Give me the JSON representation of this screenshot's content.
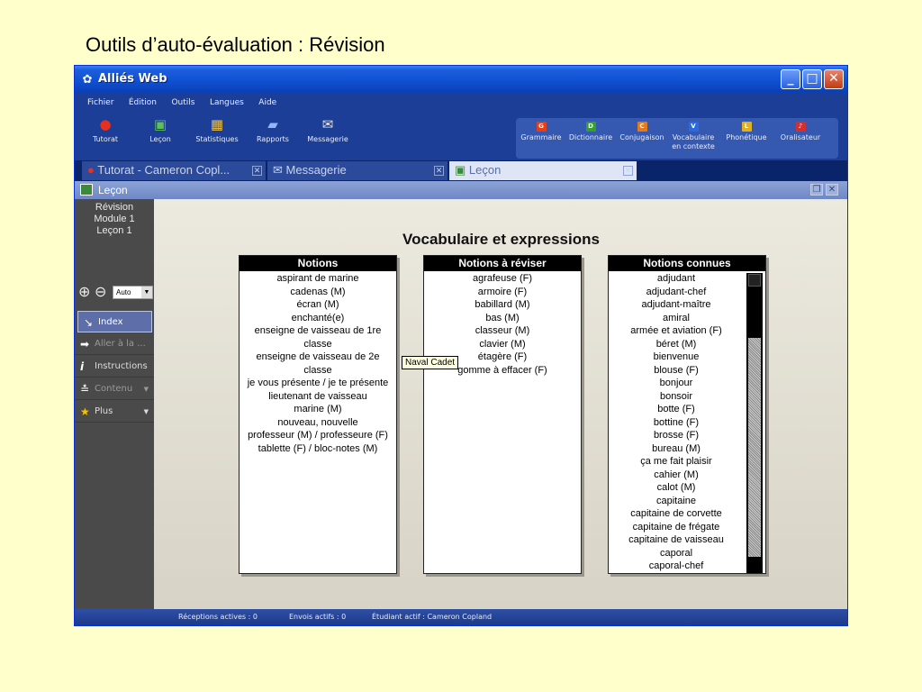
{
  "slide": {
    "title": "Outils d’auto-évaluation : Révision"
  },
  "window": {
    "title": "Alliés Web"
  },
  "menu": [
    "Fichier",
    "Édition",
    "Outils",
    "Langues",
    "Aide"
  ],
  "toolbar": {
    "items": [
      {
        "label": "Tutorat",
        "icon": "apple-icon"
      },
      {
        "label": "Leçon",
        "icon": "lesson-icon"
      },
      {
        "label": "Statistiques",
        "icon": "chart-icon"
      },
      {
        "label": "Rapports",
        "icon": "folder-icon"
      },
      {
        "label": "Messagerie",
        "icon": "mail-icon"
      }
    ],
    "references": [
      {
        "letter": "G",
        "label": "Grammaire",
        "color": "#e0401a"
      },
      {
        "letter": "D",
        "label": "Dictionnaire",
        "color": "#33a02c"
      },
      {
        "letter": "C",
        "label": "Conjugaison",
        "color": "#e07b20"
      },
      {
        "letter": "V",
        "label": "Vocabulaire en contexte",
        "color": "#2a6ae0"
      },
      {
        "letter": "L",
        "label": "Phonétique",
        "color": "#e0b020"
      },
      {
        "letter": "",
        "label": "Oralisateur",
        "color": "#d03030"
      }
    ]
  },
  "tabs": [
    {
      "label": "Tutorat - Cameron Copl..."
    },
    {
      "label": "Messagerie"
    },
    {
      "label": "Leçon"
    }
  ],
  "panel": {
    "title": "Leçon"
  },
  "sidebar": {
    "crumb": [
      "Révision",
      "Module 1",
      "Leçon 1"
    ],
    "zoom": "Auto",
    "items": [
      {
        "label": "Index"
      },
      {
        "label": "Aller à la ..."
      },
      {
        "label": "Instructions"
      },
      {
        "label": "Contenu"
      },
      {
        "label": "Plus"
      }
    ]
  },
  "main": {
    "title": "Vocabulaire et expressions",
    "columns": [
      {
        "header": "Notions",
        "items": [
          "aspirant de marine",
          "cadenas (M)",
          "écran (M)",
          "enchanté(e)",
          "enseigne de vaisseau de 1re classe",
          "enseigne de vaisseau de 2e classe",
          "je vous présente / je te présente",
          "lieutenant de vaisseau",
          "marine (M)",
          "nouveau, nouvelle",
          "professeur (M) / professeure (F)",
          "tablette (F) / bloc-notes (M)"
        ]
      },
      {
        "header": "Notions à réviser",
        "items": [
          "agrafeuse (F)",
          "armoire (F)",
          "babillard (M)",
          "bas (M)",
          "classeur (M)",
          "clavier (M)",
          "étagère (F)",
          "gomme à effacer (F)"
        ]
      },
      {
        "header": "Notions connues",
        "items": [
          "adjudant",
          "adjudant-chef",
          "adjudant-maître",
          "amiral",
          "armée et aviation (F)",
          "béret (M)",
          "bienvenue",
          "blouse (F)",
          "bonjour",
          "bonsoir",
          "botte (F)",
          "bottine (F)",
          "brosse (F)",
          "bureau (M)",
          "ça me fait plaisir",
          "cahier (M)",
          "calot (M)",
          "capitaine",
          "capitaine de corvette",
          "capitaine de frégate",
          "capitaine de vaisseau",
          "caporal",
          "caporal-chef"
        ]
      }
    ],
    "tooltip": "Naval Cadet"
  },
  "status": {
    "receptions": "Réceptions actives : 0",
    "envois": "Envois actifs : 0",
    "etudiant": "Étudiant actif : Cameron Copland"
  }
}
